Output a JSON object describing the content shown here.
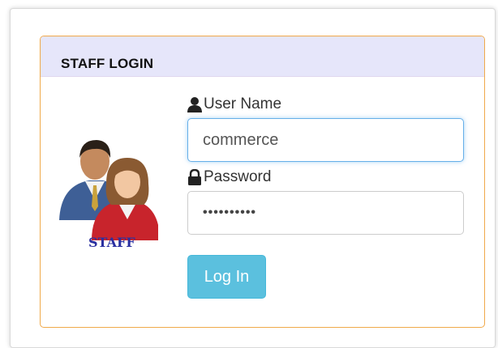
{
  "panel": {
    "title": "STAFF LOGIN"
  },
  "avatar": {
    "caption": "STAFF"
  },
  "form": {
    "username_label": "User Name",
    "username_value": "commerce",
    "password_label": "Password",
    "password_value": "••••••••••",
    "login_label": "Log In"
  },
  "colors": {
    "panel_border": "#f0a94a",
    "heading_bg": "#e6e6fa",
    "button_bg": "#5bc0de",
    "focus_border": "#66afe9"
  }
}
